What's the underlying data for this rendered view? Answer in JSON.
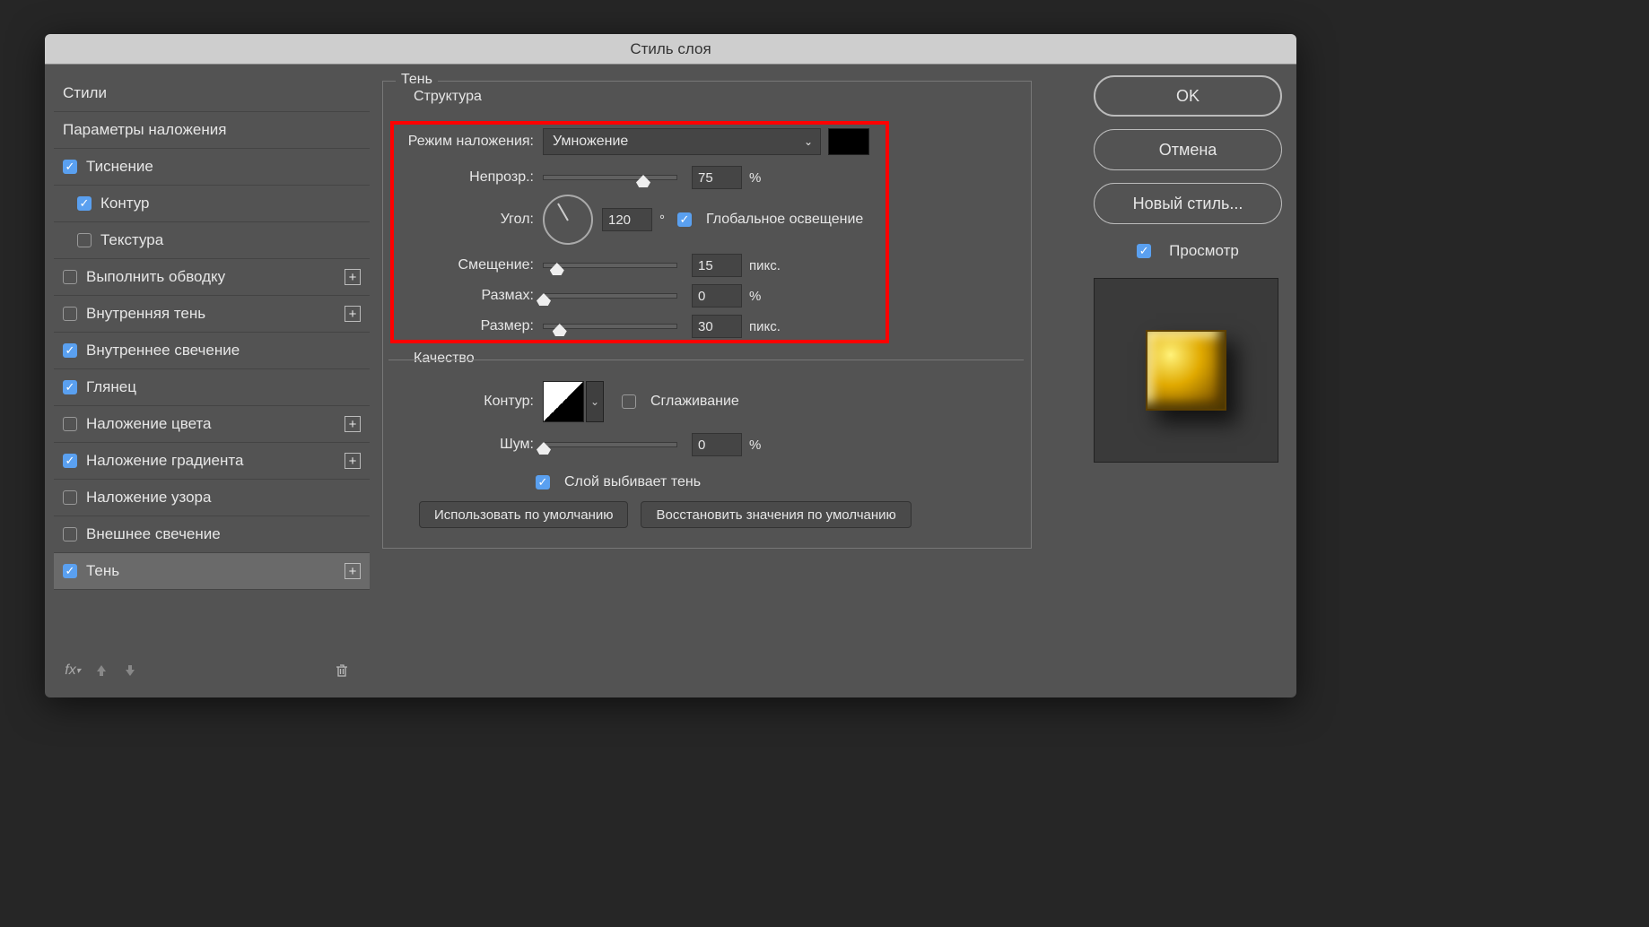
{
  "window": {
    "title": "Стиль слоя"
  },
  "sidebar": {
    "styles": "Стили",
    "blending": "Параметры наложения",
    "items": [
      {
        "label": "Тиснение",
        "checked": true,
        "plus": false
      },
      {
        "label": "Контур",
        "checked": true,
        "sub": true
      },
      {
        "label": "Текстура",
        "checked": false,
        "sub": true
      },
      {
        "label": "Выполнить обводку",
        "checked": false,
        "plus": true
      },
      {
        "label": "Внутренняя тень",
        "checked": false,
        "plus": true
      },
      {
        "label": "Внутреннее свечение",
        "checked": true
      },
      {
        "label": "Глянец",
        "checked": true
      },
      {
        "label": "Наложение цвета",
        "checked": false,
        "plus": true
      },
      {
        "label": "Наложение градиента",
        "checked": true,
        "plus": true
      },
      {
        "label": "Наложение узора",
        "checked": false
      },
      {
        "label": "Внешнее свечение",
        "checked": false
      },
      {
        "label": "Тень",
        "checked": true,
        "plus": true,
        "selected": true
      }
    ],
    "fx_label": "fx"
  },
  "panel": {
    "outerLegend": "Тень",
    "structure": "Структура",
    "blendModeLabel": "Режим наложения:",
    "blendModeValue": "Умножение",
    "shadowColor": "#000000",
    "opacityLabel": "Непрозр.:",
    "opacityValue": "75",
    "opacityUnit": "%",
    "angleLabel": "Угол:",
    "angleValue": "120",
    "angleUnit": "°",
    "globalLightLabel": "Глобальное освещение",
    "globalLightChecked": true,
    "distanceLabel": "Смещение:",
    "distanceValue": "15",
    "distanceUnit": "пикс.",
    "spreadLabel": "Размах:",
    "spreadValue": "0",
    "spreadUnit": "%",
    "sizeLabel": "Размер:",
    "sizeValue": "30",
    "sizeUnit": "пикс.",
    "qualityLegend": "Качество",
    "contourLabel": "Контур:",
    "antialiasLabel": "Сглаживание",
    "antialiasChecked": false,
    "noiseLabel": "Шум:",
    "noiseValue": "0",
    "noiseUnit": "%",
    "knockoutLabel": "Слой выбивает тень",
    "knockoutChecked": true,
    "makeDefault": "Использовать по умолчанию",
    "resetDefault": "Восстановить значения по умолчанию"
  },
  "right": {
    "ok": "OK",
    "cancel": "Отмена",
    "newStyle": "Новый стиль...",
    "preview": "Просмотр",
    "previewChecked": true
  }
}
